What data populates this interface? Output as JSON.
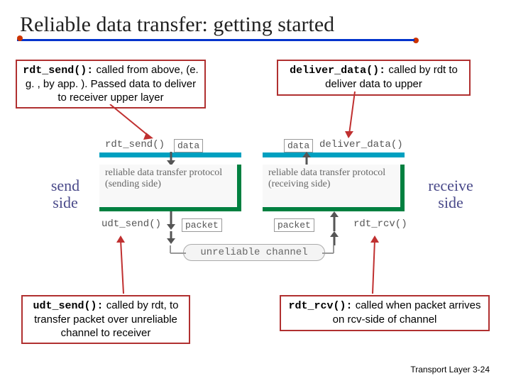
{
  "title": "Reliable data transfer: getting started",
  "boxes": {
    "rdt_send_fn": "rdt_send():",
    "rdt_send_txt": " called from above, (e. g. , by app. ). Passed data to deliver to receiver upper layer",
    "deliver_data_fn": "deliver_data():",
    "deliver_data_txt": " called by rdt to deliver data to upper",
    "udt_send_fn": "udt_send():",
    "udt_send_txt": " called by rdt, to transfer packet over unreliable channel to receiver",
    "rdt_rcv_fn": "rdt_rcv():",
    "rdt_rcv_txt": " called when packet arrives on rcv-side of channel"
  },
  "sides": {
    "send": "send side",
    "receive": "receive side"
  },
  "diagram": {
    "proto_send": "reliable data transfer protocol (sending side)",
    "proto_recv": "reliable data transfer protocol (receiving side)",
    "rdt_send": "rdt_send()",
    "deliver_data": "deliver_data()",
    "udt_send": "udt_send()",
    "rdt_rcv": "rdt_rcv()",
    "data": "data",
    "packet": "packet",
    "channel": "unreliable channel"
  },
  "footer": {
    "chapter": "Transport Layer ",
    "page": "3-24"
  }
}
